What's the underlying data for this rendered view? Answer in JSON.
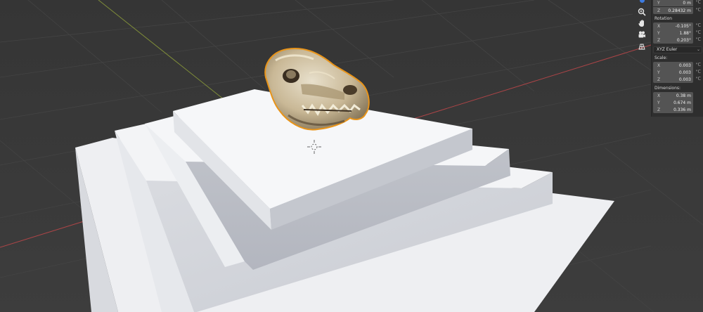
{
  "viewport": {
    "background": "#3a3a3a",
    "floor_color": "#f2f2f4",
    "x_axis_color": "#c0474a",
    "y_axis_color": "#8a9a3a",
    "selection_outline": "#e8941a",
    "object": "skull"
  },
  "navigation_gizmo": {
    "buttons": [
      "zoom-icon",
      "hand-pan-icon",
      "camera-icon",
      "grid-ortho-icon"
    ]
  },
  "npanel": {
    "location": {
      "y": {
        "axis": "Y",
        "value": "0 m"
      },
      "z": {
        "axis": "Z",
        "value": "0.28432 m"
      }
    },
    "rotation": {
      "label": "Rotation",
      "x": {
        "axis": "X",
        "value": "-0.105°"
      },
      "y": {
        "axis": "Y",
        "value": "1.88°"
      },
      "z": {
        "axis": "Z",
        "value": "0.203°"
      },
      "mode": "XYZ Euler"
    },
    "scale": {
      "label": "Scale:",
      "x": {
        "axis": "X",
        "value": "0.003"
      },
      "y": {
        "axis": "Y",
        "value": "0.003"
      },
      "z": {
        "axis": "Z",
        "value": "0.003"
      }
    },
    "dimensions": {
      "label": "Dimensions:",
      "x": {
        "axis": "X",
        "value": "0.38 m"
      },
      "y": {
        "axis": "Y",
        "value": "0.674 m"
      },
      "z": {
        "axis": "Z",
        "value": "0.336 m"
      }
    },
    "lock_glyph": "\"ᑕ"
  }
}
